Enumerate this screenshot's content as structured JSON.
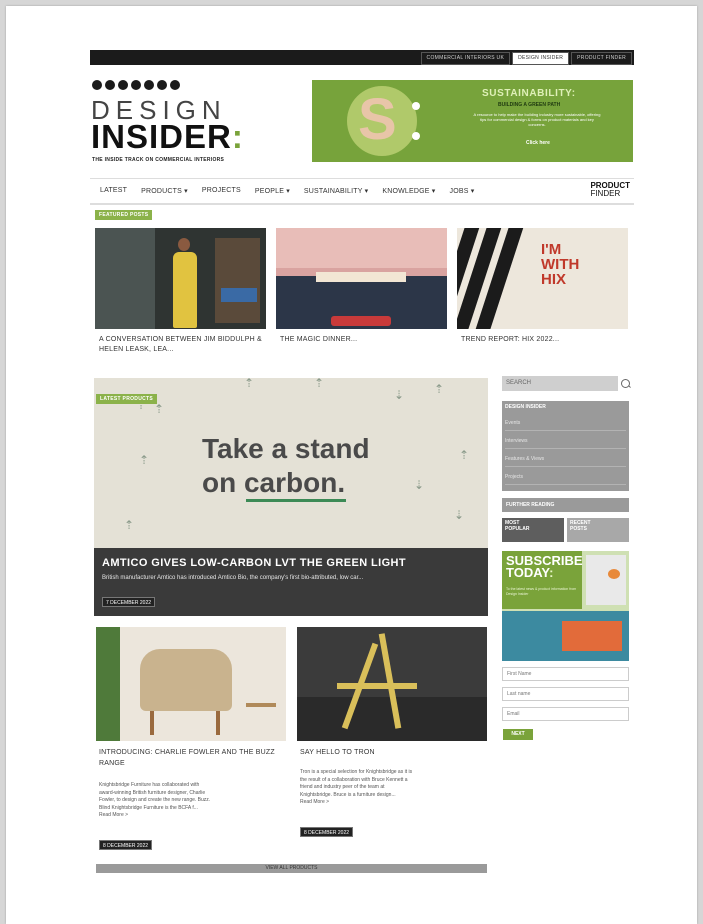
{
  "top_links": [
    "COMMERCIAL INTERIORS UK",
    "DESIGN INSIDER",
    "PRODUCT FINDER"
  ],
  "brand": {
    "line1": "DESIGN",
    "line2": "INSIDER",
    "colon": ":",
    "tagline": "THE INSIDE TRACK ON COMMERCIAL INTERIORS"
  },
  "banner": {
    "letter": "S",
    "title": "SUSTAINABILITY:",
    "subtitle": "BUILDING A GREEN PATH",
    "body": "A resource to help make the building industry more sustainable, offering tips for commercial design & forms on product materials and key concerns.",
    "button": "Click here"
  },
  "nav": {
    "items": [
      "LATEST",
      "PRODUCTS ▾",
      "PROJECTS",
      "PEOPLE ▾",
      "SUSTAINABILITY ▾",
      "KNOWLEDGE ▾",
      "JOBS ▾"
    ],
    "pf_top": "PRODUCT",
    "pf_bottom": "FINDER"
  },
  "featured": {
    "label": "FEATURED POSTS",
    "posts": [
      {
        "caption": "A CONVERSATION BETWEEN JIM BIDDULPH & HELEN LEASK, LEA..."
      },
      {
        "caption": "THE MAGIC DINNER..."
      },
      {
        "caption": "TREND REPORT: HIX 2022..."
      }
    ],
    "sign": "I'M WITH HIX"
  },
  "hero": {
    "label": "LATEST PRODUCTS",
    "line1": "Take a stand",
    "line2": "on carbon.",
    "title": "AMTICO GIVES LOW-CARBON LVT THE GREEN LIGHT",
    "desc": "British manufacturer Amtico has introduced Amtico Bio, the company's first bio-attributed, low car...",
    "date": "7 DECEMBER 2022"
  },
  "products": [
    {
      "title1": "INTRODUCING: CHARLIE FOWLER AND THE BUZZ",
      "title2": "RANGE",
      "body": [
        "Knightsbridge Furniture has collaborated with",
        "award-winning British furniture designer, Charlie",
        "Fowler, to design and create the new range. Buzz.",
        "Blind Knightsbridge Furniture is the BCFA f...",
        "Read More >"
      ],
      "date": "8 DECEMBER 2022"
    },
    {
      "title1": "SAY HELLO TO TRON",
      "title2": "",
      "body": [
        "Tron is a special selection for Knightsbridge as it is",
        "the result of a collaboration with Bruce Kennett a",
        "friend and industry peer of the team at",
        "Knightsbridge. Bruce is a furniture design...",
        "Read More >"
      ],
      "date": "8 DECEMBER 2022"
    }
  ],
  "view_all": "VIEW ALL PRODUCTS",
  "sidebar": {
    "search_placeholder": "SEARCH",
    "di_heading": "DESIGN INSIDER",
    "di_items": [
      "Events",
      "Interviews",
      "Features & Views",
      "Projects"
    ],
    "further_reading": "FURTHER READING",
    "tabs": [
      {
        "l1": "MOST",
        "l2": "POPULAR"
      },
      {
        "l1": "RECENT",
        "l2": "POSTS"
      }
    ],
    "subscribe_l1": "SUBSCRIBE",
    "subscribe_l2": "TODAY",
    "subscribe_colon": ":",
    "subscribe_body": "To the latest news & product information from Design Insider",
    "fields": [
      "First Name",
      "Last name",
      "Email"
    ],
    "next": "NEXT"
  },
  "colors": {
    "accent": "#7aa33a",
    "dark": "#1b1b1b"
  }
}
